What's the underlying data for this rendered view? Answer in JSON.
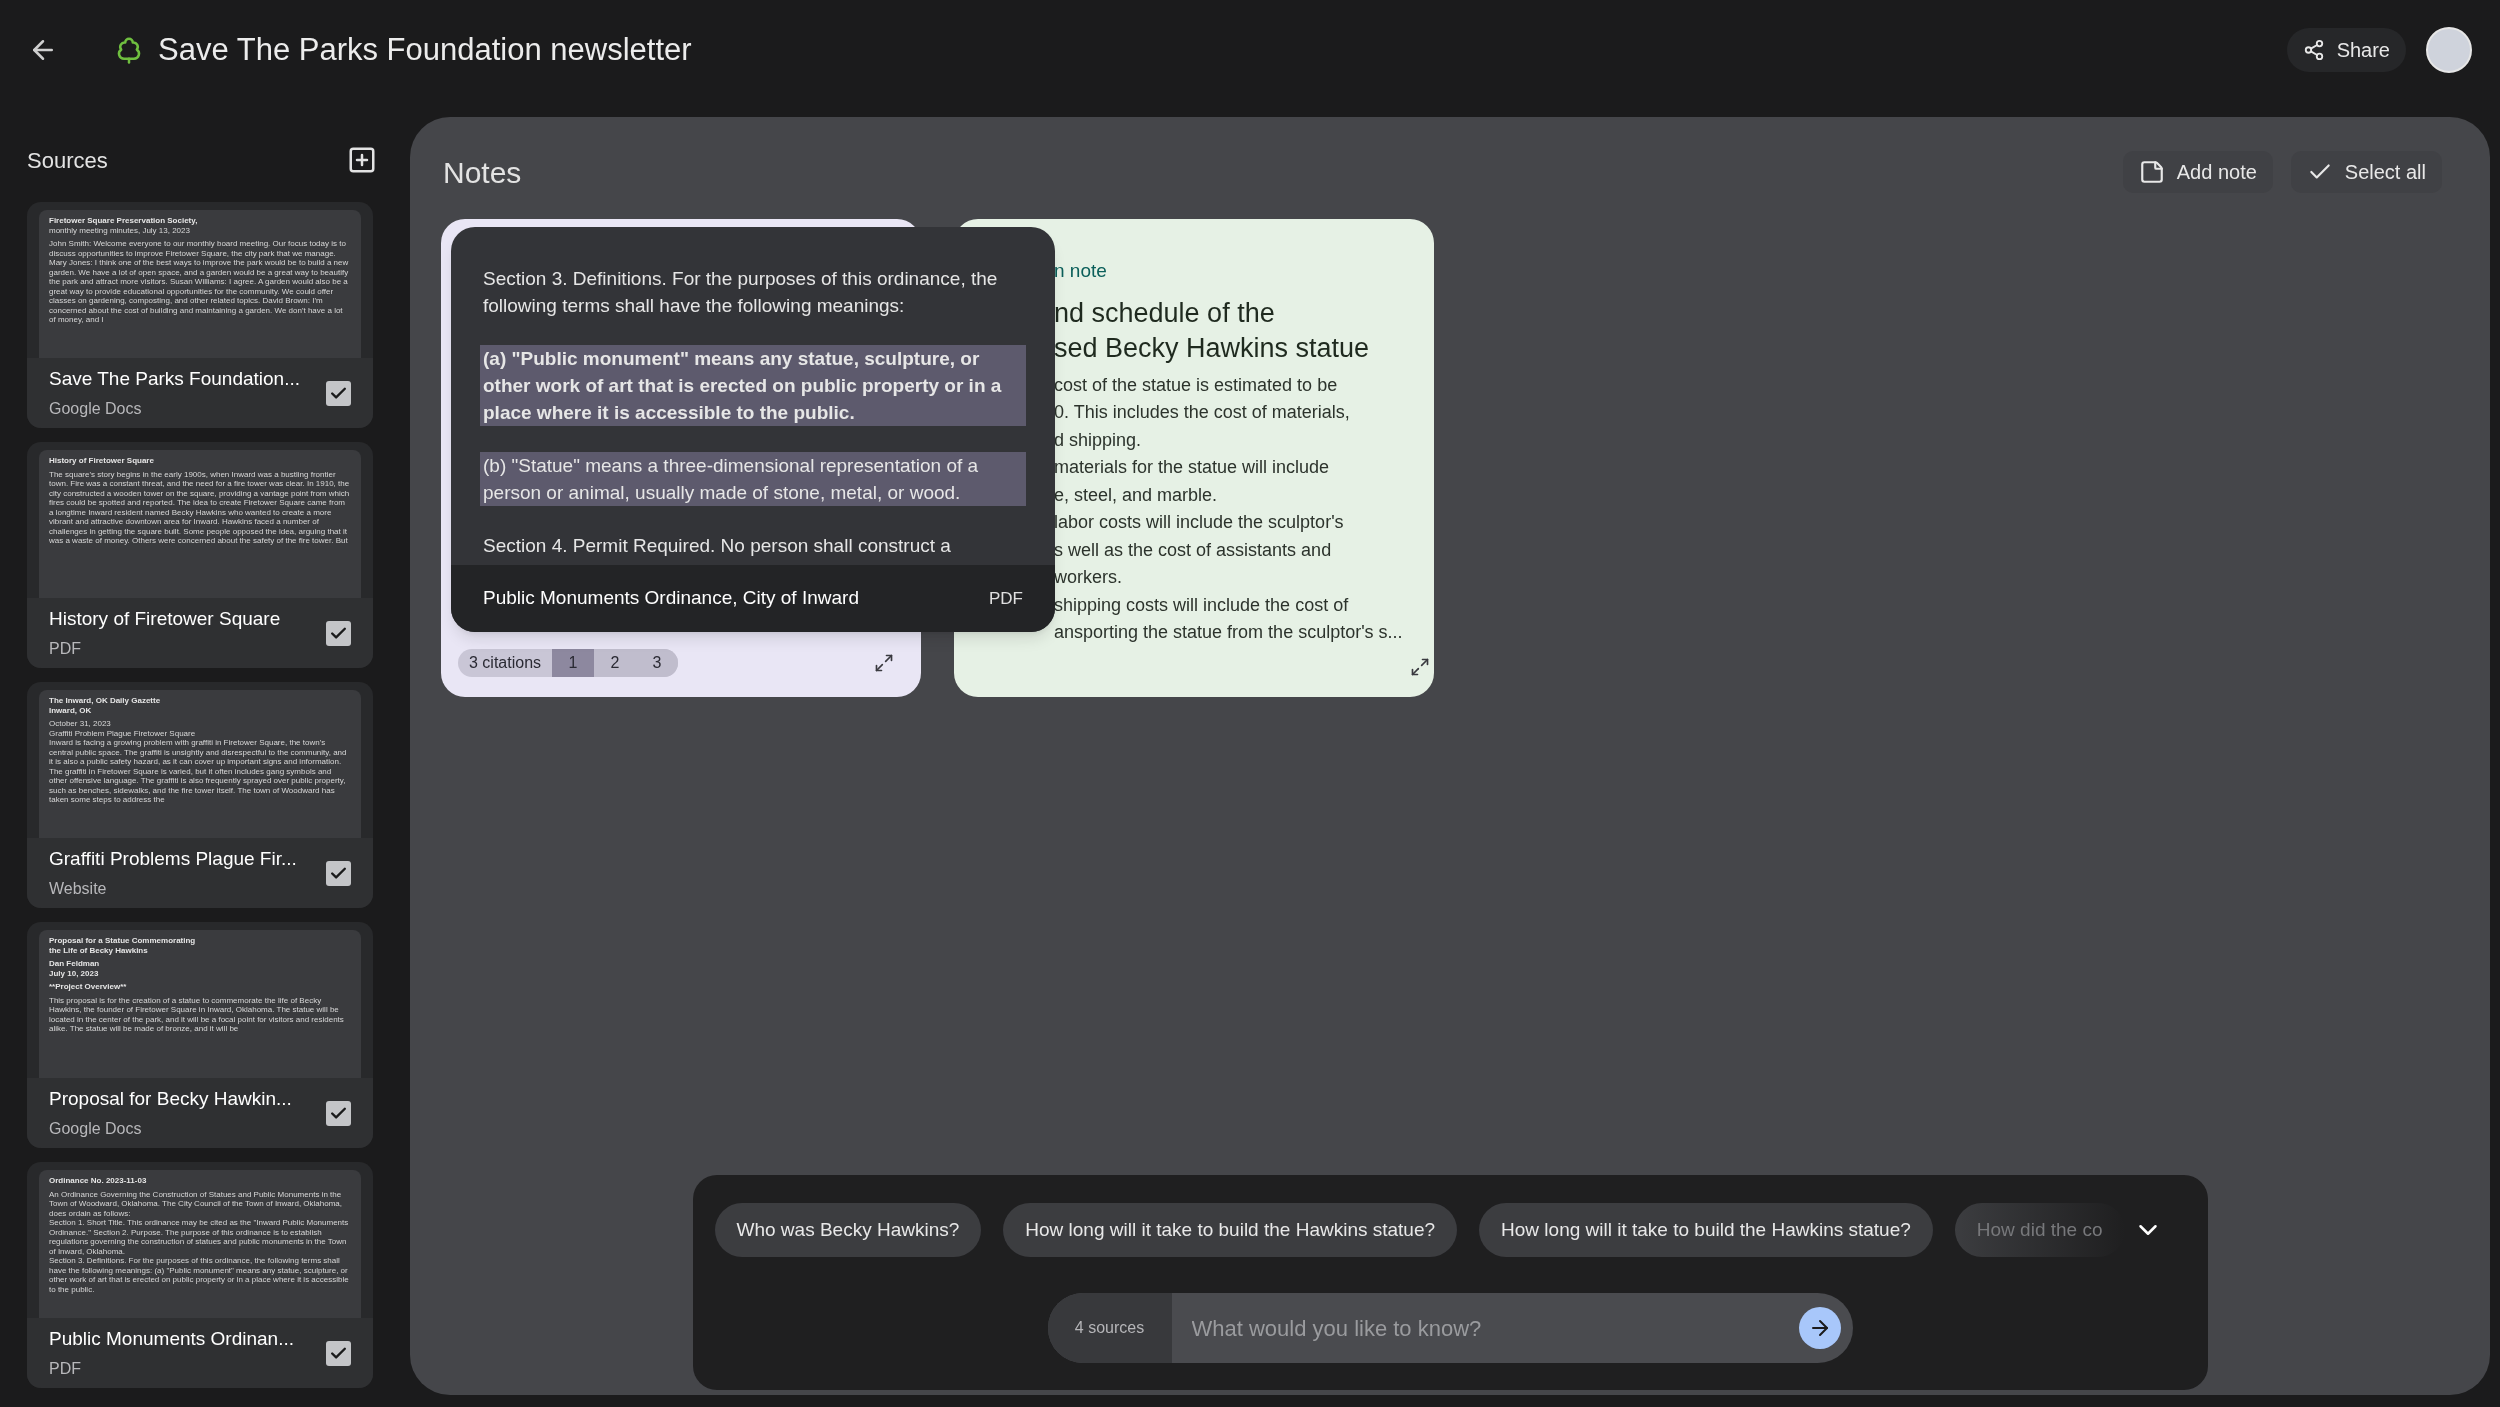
{
  "header": {
    "title": "Save The Parks Foundation newsletter",
    "share": "Share"
  },
  "sources_panel": {
    "title": "Sources",
    "sources": [
      {
        "title": "Save The Parks Foundation...",
        "type": "Google Docs",
        "checked": true,
        "preview": [
          {
            "kind": "heading",
            "text": "Firetower Square Preservation Society,"
          },
          {
            "kind": "text",
            "text": "monthly meeting minutes, July 13, 2023"
          },
          {
            "kind": "gap"
          },
          {
            "kind": "text",
            "text": "John Smith: Welcome everyone to our monthly board meeting. Our focus today is to discuss opportunities to improve Firetower Square, the city park that we manage. Mary Jones: I think one of the best ways to improve the park would be to build a new garden. We have a lot of open space, and a garden would be a great way to beautify the park and attract more visitors. Susan Williams: I agree. A garden would also be a great way to provide educational opportunities for the community. We could offer classes on gardening, composting, and other related topics. David Brown: I'm concerned about the cost of building and maintaining a garden. We don't have a lot of money, and I"
          }
        ]
      },
      {
        "title": "History of Firetower Square",
        "type": "PDF",
        "checked": true,
        "preview": [
          {
            "kind": "heading",
            "text": "History of Firetower Square"
          },
          {
            "kind": "gap"
          },
          {
            "kind": "text",
            "text": "The square's story begins in the early 1900s, when Inward was a bustling frontier town. Fire was a constant threat, and the need for a fire tower was clear. In 1910, the city constructed a wooden tower on the square, providing a vantage point from which fires could be spotted and reported. The idea to create Firetower Square came from a longtime Inward resident named Becky Hawkins who wanted to create a more vibrant and attractive downtown area for Inward. Hawkins faced a number of challenges in getting the square built. Some people opposed the idea, arguing that it was a waste of money. Others were concerned about the safety of the fire tower. But"
          }
        ]
      },
      {
        "title": "Graffiti Problems Plague Fir...",
        "type": "Website",
        "checked": true,
        "preview": [
          {
            "kind": "heading",
            "text": "The Inward, OK Daily Gazette"
          },
          {
            "kind": "heading",
            "text": "Inward, OK"
          },
          {
            "kind": "gap"
          },
          {
            "kind": "text",
            "text": "October 31, 2023"
          },
          {
            "kind": "text",
            "text": "Graffiti Problem Plague Firetower Square"
          },
          {
            "kind": "text",
            "text": "Inward is facing a growing problem with graffiti in Firetower Square, the town's central public space. The graffiti is unsightly and disrespectful to the community, and it is also a public safety hazard, as it can cover up important signs and information. The graffiti in Firetower Square is varied, but it often includes gang symbols and other offensive language. The graffiti is also frequently sprayed over public property, such as benches, sidewalks, and the fire tower itself. The town of Woodward has taken some steps to address the"
          }
        ]
      },
      {
        "title": "Proposal for Becky Hawkin...",
        "type": "Google Docs",
        "checked": true,
        "preview": [
          {
            "kind": "heading",
            "text": "Proposal for a Statue Commemorating"
          },
          {
            "kind": "heading",
            "text": "the Life of Becky Hawkins"
          },
          {
            "kind": "gap"
          },
          {
            "kind": "heading",
            "text": "Dan Feldman"
          },
          {
            "kind": "heading",
            "text": "July 10, 2023"
          },
          {
            "kind": "gap"
          },
          {
            "kind": "heading",
            "text": "**Project Overview**"
          },
          {
            "kind": "gap"
          },
          {
            "kind": "text",
            "text": "This proposal is for the creation of a statue to commemorate the life of Becky Hawkins, the founder of Firetower Square in Inward, Oklahoma. The statue will be located in the center of the park, and it will be a focal point for visitors and residents alike. The statue will be made of bronze, and it will be"
          }
        ]
      },
      {
        "title": "Public Monuments Ordinan...",
        "type": "PDF",
        "checked": true,
        "preview": [
          {
            "kind": "heading",
            "text": "Ordinance No. 2023-11-03"
          },
          {
            "kind": "gap"
          },
          {
            "kind": "text",
            "text": "An Ordinance Governing the Construction of Statues and Public Monuments in the Town of Woodward, Oklahoma. The City Council of the Town of Inward, Oklahoma, does ordain as follows:"
          },
          {
            "kind": "text",
            "text": "Section 1. Short Title. This ordinance may be cited as the \"Inward Public Monuments Ordinance.\" Section 2. Purpose. The purpose of this ordinance is to establish regulations governing the construction of statues and public monuments in the Town of Inward, Oklahoma."
          },
          {
            "kind": "text",
            "text": "Section 3. Definitions. For the purposes of this ordinance, the following terms shall have the following meanings: (a) \"Public monument\" means any statue, sculpture, or other work of art that is erected on public property or in a place where it is accessible to the public."
          }
        ]
      }
    ]
  },
  "notes_panel": {
    "title": "Notes",
    "actions": [
      {
        "kind": "add",
        "label": "Add note"
      },
      {
        "kind": "select",
        "label": "Select all"
      }
    ],
    "cards": [
      {
        "kind": "citation",
        "citations_label": "3 citations",
        "citations": [
          {
            "label": "1",
            "selected": true
          },
          {
            "label": "2",
            "selected": false
          },
          {
            "label": "3",
            "selected": false
          }
        ]
      },
      {
        "kind": "written",
        "note_type": "n note",
        "title_lines": [
          "nd schedule of the",
          "sed Becky Hawkins statue"
        ],
        "body_lines": [
          "cost of the statue is estimated to be",
          "0. This includes the cost of materials,",
          "d shipping.",
          "materials for the statue will include",
          "e, steel, and marble.",
          "labor costs will include the sculptor's",
          "s well as the cost of assistants and",
          "workers.",
          "shipping costs will include the cost of",
          "ansporting the statue from the sculptor's s..."
        ]
      }
    ],
    "citation_popup": {
      "paragraphs": [
        {
          "text": "Section 3. Definitions. For the purposes of this ordinance, the following terms shall have the following meanings:",
          "highlighted": false,
          "bold": false
        },
        {
          "text": "(a) \"Public monument\" means any statue, sculpture, or other work of art that is erected on public property or in a place where it is accessible to the public.",
          "highlighted": true,
          "bold": true
        },
        {
          "text": "(b) \"Statue\" means a three-dimensional representation of a person or animal, usually made of stone, metal, or wood.",
          "highlighted": true,
          "bold": false
        },
        {
          "text": "Section 4. Permit Required. No person shall construct a",
          "highlighted": false,
          "bold": false
        }
      ],
      "source": "Public Monuments Ordinance, City of Inward",
      "source_type": "PDF"
    }
  },
  "chat": {
    "suggestions": [
      {
        "text": "Who was Becky Hawkins?",
        "faded": false
      },
      {
        "text": "How long will it take to build the Hawkins statue?",
        "faded": false
      },
      {
        "text": "How long will it take to build the Hawkins statue?",
        "faded": false
      },
      {
        "text": "How did the co",
        "faded": true
      }
    ],
    "sources_count": "4 sources",
    "input": {
      "placeholder": "What would you like to know?"
    }
  }
}
